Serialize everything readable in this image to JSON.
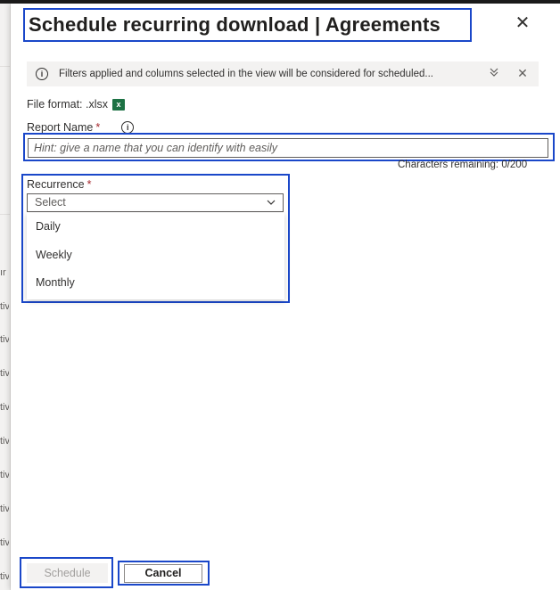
{
  "dialog": {
    "title": "Schedule recurring download | Agreements",
    "close_glyph": "✕"
  },
  "info_bar": {
    "icon_glyph": "i",
    "text": "Filters applied and columns selected in the view will be considered for scheduled...",
    "expand_glyph": "⌄⌄",
    "close_glyph": "✕"
  },
  "file_format": {
    "label": "File format: .xlsx",
    "icon": "excel-icon",
    "icon_glyph": "x"
  },
  "report_name": {
    "label": "Report Name",
    "required_mark": "*",
    "info_glyph": "i",
    "placeholder": "Hint: give a name that you can identify with easily",
    "value": "",
    "chars_remaining": "Characters remaining: 0/200"
  },
  "recurrence": {
    "label": "Recurrence",
    "required_mark": "*",
    "selected": "Select",
    "options": [
      "Daily",
      "Weekly",
      "Monthly"
    ]
  },
  "footer": {
    "schedule_label": "Schedule",
    "cancel_label": "Cancel"
  },
  "background": {
    "fragments": [
      "ır",
      "tiv",
      "tiv",
      "tiv",
      "tiv",
      "tiv",
      "tiv",
      "tiv",
      "tiv",
      "tiv"
    ]
  },
  "colors": {
    "highlight_border": "#1a47c9",
    "required": "#a4262c",
    "info_bar_bg": "#f3f2f1",
    "excel_green": "#1d7244"
  }
}
